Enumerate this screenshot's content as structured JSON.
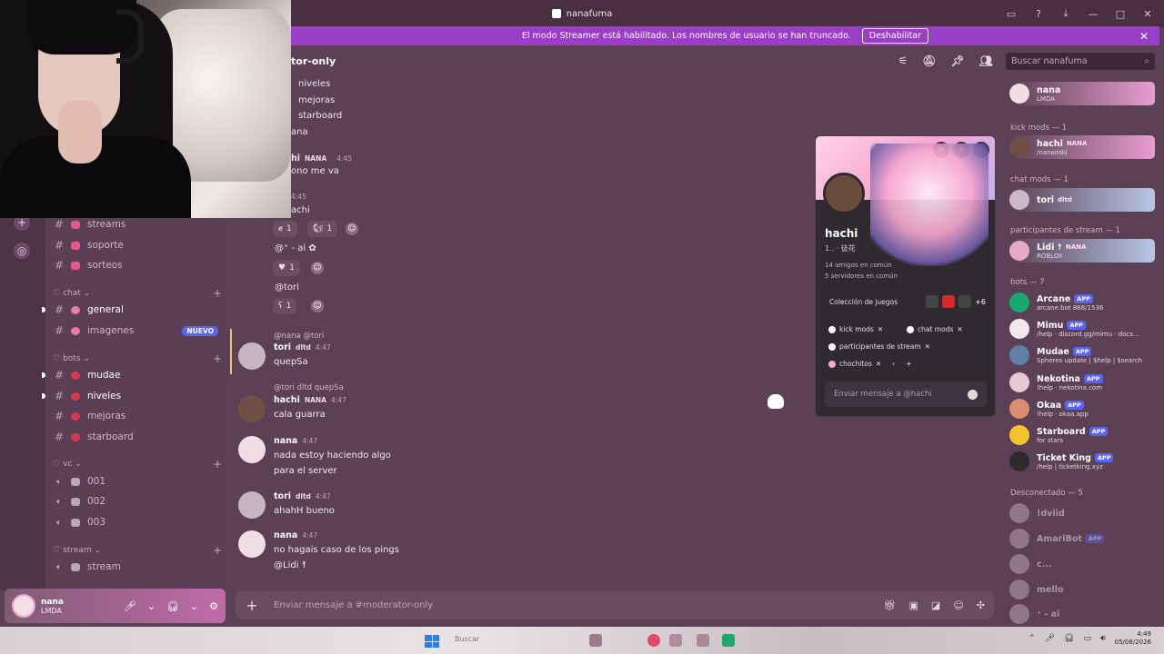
{
  "window": {
    "title": "nanafuma"
  },
  "banner": {
    "text": "El modo Streamer está habilitado. Los nombres de usuario se han truncado.",
    "button": "Deshabilitar"
  },
  "channel_header": {
    "name": "tor-only"
  },
  "search": {
    "placeholder": "Buscar nanafuma"
  },
  "sidebar": {
    "channels_top": [
      "streams",
      "soporte",
      "sorteos"
    ],
    "cat_chat": "chat",
    "chat_channels": [
      "general",
      "imagenes"
    ],
    "new_badge": "NUEVO",
    "cat_bots": "bots",
    "bot_channels": [
      "mudae",
      "niveles",
      "mejoras",
      "starboard"
    ],
    "cat_vc": "vc",
    "vc_channels": [
      "001",
      "002",
      "003"
    ],
    "cat_stream": "stream",
    "stream_channels": [
      "stream"
    ]
  },
  "user_panel": {
    "name": "nana",
    "status": "LMDA"
  },
  "chat": {
    "top_lines": [
      "niveles",
      "mejoras",
      "starboard",
      "ana"
    ],
    "msg_a_name": "hi",
    "msg_a_tag": "NANA",
    "msg_a_time": "4:45",
    "msg_a_body": "ono me va",
    "msg_b_time": "4:45",
    "msg_b_body": "achi",
    "reactions": [
      {
        "count": "1"
      },
      {
        "count": "1"
      }
    ],
    "mention_ai": "@⁺ - ai ✿",
    "reaction_2_count": "1",
    "mention_tori": "@tori",
    "reaction_3_count": "1",
    "messages": [
      {
        "reply": "@nana  @tori",
        "name": "tori",
        "tag": "dltd",
        "time": "4:47",
        "body": "quepSa"
      },
      {
        "reply": "@tori  dltd  quepSa",
        "name": "hachi",
        "tag": "NANA",
        "time": "4:47",
        "body": "cala guarra"
      },
      {
        "name": "nana",
        "time": "4:47",
        "body1": "nada estoy haciendo algo",
        "body2": "para el server"
      },
      {
        "name": "tori",
        "tag": "dltd",
        "time": "4:47",
        "body": "ahahH bueno"
      },
      {
        "name": "nana",
        "time": "4:47",
        "body1": "no hagais caso de los pings",
        "body2": "@Lidi ☨"
      }
    ]
  },
  "compose": {
    "placeholder": "Enviar mensaje a #moderator-only"
  },
  "profile": {
    "name": "hachi",
    "subtitle": "1.. · 徒花",
    "friends": "14 amigos en común",
    "servers": "5 servidores en común",
    "games": "Colección de juegos",
    "games_more": "+6",
    "roles": [
      "kick mods",
      "chat mods",
      "participantes de stream",
      "chochitos"
    ],
    "message_placeholder": "Enviar mensaje a @hachi"
  },
  "members": {
    "top_member": {
      "name": "nana",
      "status": "LMDA"
    },
    "cat_kick": "kick mods — 1",
    "kick": {
      "name": "hachi",
      "tag": "NANA",
      "status": "/nanaoski"
    },
    "cat_chat": "chat mods — 1",
    "chatmod": {
      "name": "tori",
      "tag": "dltd"
    },
    "cat_stream": "participantes de stream — 1",
    "streamer": {
      "name": "Lidi ☨",
      "tag": "NANA",
      "status": "ROBLOX"
    },
    "cat_bots": "bots — 7",
    "app_label": "APP",
    "bots": [
      {
        "name": "Arcane",
        "status": "arcane.bot 868/1536"
      },
      {
        "name": "Mimu",
        "status": "/help · discord.gg/mimu · docs..."
      },
      {
        "name": "Mudae",
        "status": "Spheres update | $help | $search"
      },
      {
        "name": "Nekotina",
        "status": "!help · nekotina.com"
      },
      {
        "name": "Okaa",
        "status": "!help · okaa.app"
      },
      {
        "name": "Starboard",
        "status": "for stars"
      },
      {
        "name": "Ticket King",
        "status": "/help | ticketking.xyz"
      }
    ],
    "cat_offline": "Desconectado — 5",
    "offline": [
      "!dviid",
      "AmariBot",
      "c...",
      "mello",
      "⁺ - ai"
    ],
    "offline_app_index": 1
  },
  "taskbar": {
    "search": "Buscar",
    "time": "4:49",
    "date": "05/08/2026"
  }
}
